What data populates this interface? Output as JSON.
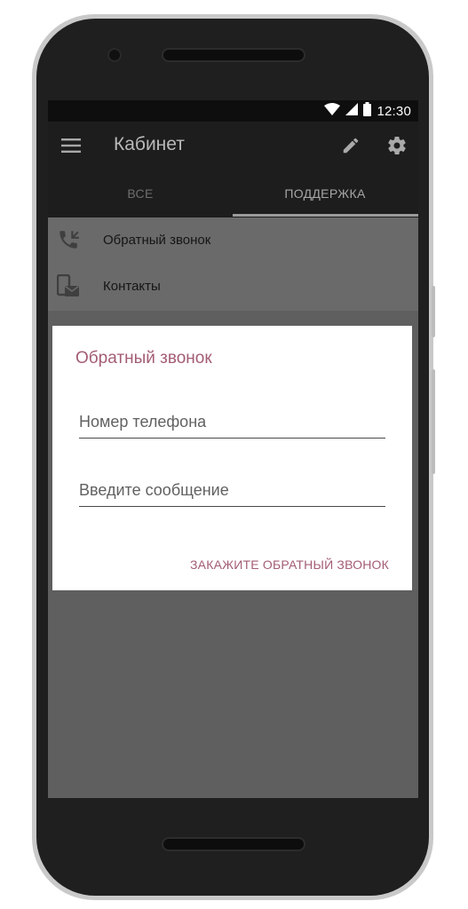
{
  "status_bar": {
    "time": "12:30",
    "icons": [
      "wifi-icon",
      "signal-icon",
      "battery-icon"
    ]
  },
  "app_bar": {
    "title": "Кабинет",
    "icons": [
      "menu-icon",
      "edit-icon",
      "settings-icon"
    ]
  },
  "tabs": [
    {
      "label": "ВСЕ",
      "selected": false
    },
    {
      "label": "ПОДДЕРЖКА",
      "selected": true
    }
  ],
  "list": {
    "items": [
      {
        "label": "Обратный звонок",
        "icon": "phone-callback-icon"
      },
      {
        "label": "Контакты",
        "icon": "contact-mail-icon"
      }
    ]
  },
  "dialog": {
    "title": "Обратный звонок",
    "phone_placeholder": "Номер телефона",
    "phone_value": "",
    "message_placeholder": "Введите сообщение",
    "message_value": "",
    "action_label": "ЗАКАЖИТЕ ОБРАТНЫЙ ЗВОНОК"
  },
  "colors": {
    "accent": "#a35d75",
    "app_bar": "#1d1d1d",
    "status_bar": "#0e0e0e",
    "scrim": "#5f5f5f"
  }
}
